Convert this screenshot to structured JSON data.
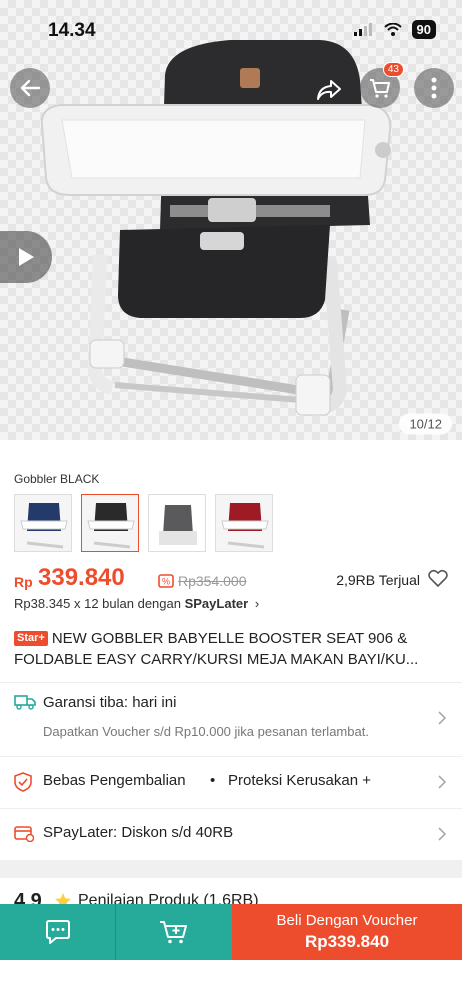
{
  "status": {
    "time": "14.34",
    "battery": "90"
  },
  "gallery": {
    "counter": "10/12",
    "cart_count": "43"
  },
  "variant": {
    "name": "Gobbler BLACK"
  },
  "price": {
    "currency": "Rp",
    "current": "339.840",
    "original": "Rp354.000",
    "sold": "2,9RB Terjual"
  },
  "installment": {
    "text": "Rp38.345 x 12 bulan dengan ",
    "brand": "SPayLater",
    "arrow": "›"
  },
  "product": {
    "badge": "Star+",
    "title": "NEW GOBBLER BABYELLE BOOSTER SEAT 906 & FOLDABLE EASY CARRY/KURSI MEJA MAKAN BAYI/KU..."
  },
  "info_rows": {
    "guarantee_label": "Garansi tiba: hari ini",
    "guarantee_sub": "Dapatkan Voucher s/d Rp10.000 jika pesanan terlambat.",
    "returns_label": "Bebas Pengembalian",
    "returns_sep": "•",
    "protection_label": "Proteksi Kerusakan +",
    "spaylater_label": "SPayLater: Diskon s/d 40RB"
  },
  "rating": {
    "score": "4.9",
    "label": "Penilaian Produk (1,6RB)"
  },
  "bottom_bar": {
    "buy_line1": "Beli Dengan Voucher",
    "buy_line2": "Rp339.840"
  },
  "colors": {
    "accent": "#ee4d2d",
    "teal": "#26aa99"
  },
  "icons": [
    "back-icon",
    "share-icon",
    "cart-icon",
    "more-icon",
    "play-icon",
    "heart-icon",
    "truck-icon",
    "shield-icon",
    "card-icon",
    "chevron-right-icon",
    "star-icon",
    "chat-icon",
    "add-to-cart-icon"
  ]
}
